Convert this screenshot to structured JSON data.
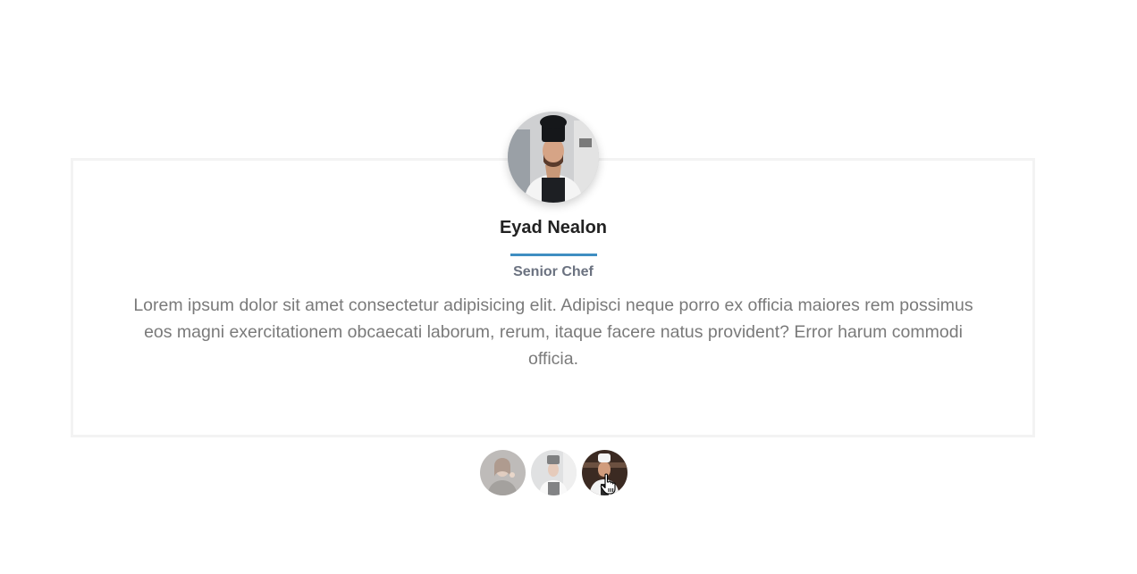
{
  "team_member": {
    "name": "Eyad Nealon",
    "role": "Senior Chef",
    "quote": "Lorem ipsum dolor sit amet consectetur adipisicing elit. Adipisci neque porro ex officia maiores rem possimus eos magni exercitationem obcaecati laborum, rerum, itaque facere natus provident? Error harum commodi officia."
  },
  "colors": {
    "accent": "#3f8ec2",
    "name_text": "#222222",
    "body_text": "#7a7a7a",
    "card_border": "#f3f3f3"
  },
  "thumbnails": [
    {
      "icon": "chef-woman-avatar-icon",
      "active": false
    },
    {
      "icon": "chef-apron-avatar-icon",
      "active": false
    },
    {
      "icon": "chef-white-uniform-avatar-icon",
      "active": true
    }
  ],
  "cursor": {
    "icon": "hand-pointer-icon"
  }
}
